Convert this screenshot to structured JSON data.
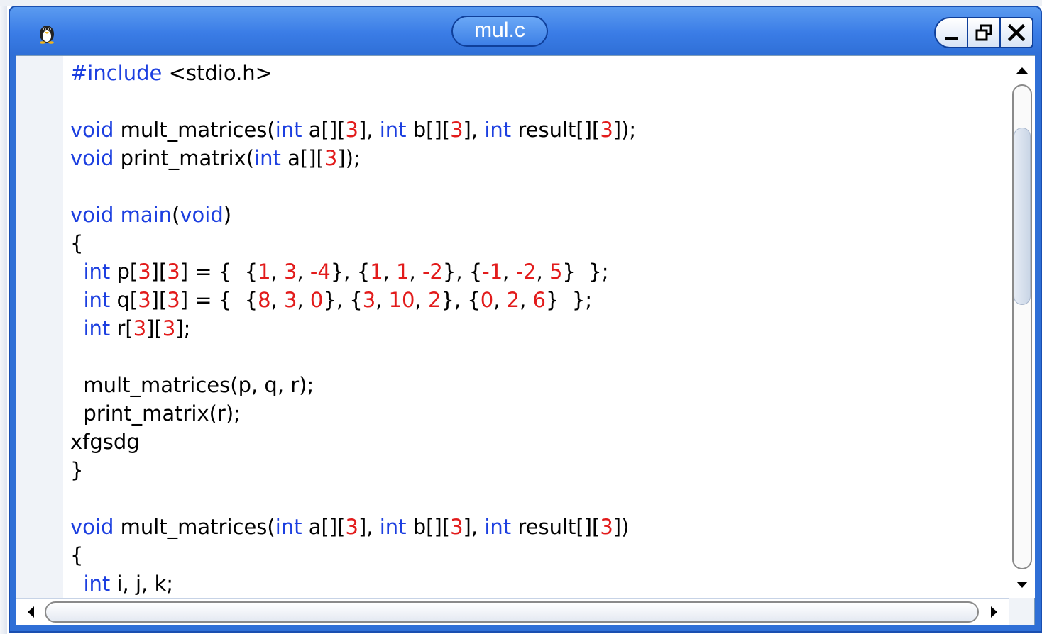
{
  "window": {
    "title": "mul.c",
    "icon": "penguin-icon",
    "controls": [
      "minimize-icon",
      "restore-icon",
      "close-icon"
    ]
  },
  "editor": {
    "lines": [
      [
        {
          "c": "kw",
          "t": "#include"
        },
        {
          "c": "t",
          "t": " <stdio.h>"
        }
      ],
      [],
      [
        {
          "c": "kw",
          "t": "void"
        },
        {
          "c": "t",
          "t": " mult_matrices("
        },
        {
          "c": "kw",
          "t": "int"
        },
        {
          "c": "t",
          "t": " a[]["
        },
        {
          "c": "num",
          "t": "3"
        },
        {
          "c": "t",
          "t": "], "
        },
        {
          "c": "kw",
          "t": "int"
        },
        {
          "c": "t",
          "t": " b[]["
        },
        {
          "c": "num",
          "t": "3"
        },
        {
          "c": "t",
          "t": "], "
        },
        {
          "c": "kw",
          "t": "int"
        },
        {
          "c": "t",
          "t": " result[]["
        },
        {
          "c": "num",
          "t": "3"
        },
        {
          "c": "t",
          "t": "]);"
        }
      ],
      [
        {
          "c": "kw",
          "t": "void"
        },
        {
          "c": "t",
          "t": " print_matrix("
        },
        {
          "c": "kw",
          "t": "int"
        },
        {
          "c": "t",
          "t": " a[]["
        },
        {
          "c": "num",
          "t": "3"
        },
        {
          "c": "t",
          "t": "]);"
        }
      ],
      [],
      [
        {
          "c": "kw",
          "t": "void"
        },
        {
          "c": "t",
          "t": " "
        },
        {
          "c": "kw",
          "t": "main"
        },
        {
          "c": "t",
          "t": "("
        },
        {
          "c": "kw",
          "t": "void"
        },
        {
          "c": "t",
          "t": ")"
        }
      ],
      [
        {
          "c": "t",
          "t": "{"
        }
      ],
      [
        {
          "c": "t",
          "t": "  "
        },
        {
          "c": "kw",
          "t": "int"
        },
        {
          "c": "t",
          "t": " p["
        },
        {
          "c": "num",
          "t": "3"
        },
        {
          "c": "t",
          "t": "]["
        },
        {
          "c": "num",
          "t": "3"
        },
        {
          "c": "t",
          "t": "] = {  {"
        },
        {
          "c": "num",
          "t": "1"
        },
        {
          "c": "t",
          "t": ", "
        },
        {
          "c": "num",
          "t": "3"
        },
        {
          "c": "t",
          "t": ", "
        },
        {
          "c": "num",
          "t": "-4"
        },
        {
          "c": "t",
          "t": "}, {"
        },
        {
          "c": "num",
          "t": "1"
        },
        {
          "c": "t",
          "t": ", "
        },
        {
          "c": "num",
          "t": "1"
        },
        {
          "c": "t",
          "t": ", "
        },
        {
          "c": "num",
          "t": "-2"
        },
        {
          "c": "t",
          "t": "}, {"
        },
        {
          "c": "num",
          "t": "-1"
        },
        {
          "c": "t",
          "t": ", "
        },
        {
          "c": "num",
          "t": "-2"
        },
        {
          "c": "t",
          "t": ", "
        },
        {
          "c": "num",
          "t": "5"
        },
        {
          "c": "t",
          "t": "}  };"
        }
      ],
      [
        {
          "c": "t",
          "t": "  "
        },
        {
          "c": "kw",
          "t": "int"
        },
        {
          "c": "t",
          "t": " q["
        },
        {
          "c": "num",
          "t": "3"
        },
        {
          "c": "t",
          "t": "]["
        },
        {
          "c": "num",
          "t": "3"
        },
        {
          "c": "t",
          "t": "] = {  {"
        },
        {
          "c": "num",
          "t": "8"
        },
        {
          "c": "t",
          "t": ", "
        },
        {
          "c": "num",
          "t": "3"
        },
        {
          "c": "t",
          "t": ", "
        },
        {
          "c": "num",
          "t": "0"
        },
        {
          "c": "t",
          "t": "}, {"
        },
        {
          "c": "num",
          "t": "3"
        },
        {
          "c": "t",
          "t": ", "
        },
        {
          "c": "num",
          "t": "10"
        },
        {
          "c": "t",
          "t": ", "
        },
        {
          "c": "num",
          "t": "2"
        },
        {
          "c": "t",
          "t": "}, {"
        },
        {
          "c": "num",
          "t": "0"
        },
        {
          "c": "t",
          "t": ", "
        },
        {
          "c": "num",
          "t": "2"
        },
        {
          "c": "t",
          "t": ", "
        },
        {
          "c": "num",
          "t": "6"
        },
        {
          "c": "t",
          "t": "}  };"
        }
      ],
      [
        {
          "c": "t",
          "t": "  "
        },
        {
          "c": "kw",
          "t": "int"
        },
        {
          "c": "t",
          "t": " r["
        },
        {
          "c": "num",
          "t": "3"
        },
        {
          "c": "t",
          "t": "]["
        },
        {
          "c": "num",
          "t": "3"
        },
        {
          "c": "t",
          "t": "];"
        }
      ],
      [],
      [
        {
          "c": "t",
          "t": "  mult_matrices(p, q, r);"
        }
      ],
      [
        {
          "c": "t",
          "t": "  print_matrix(r);"
        }
      ],
      [
        {
          "c": "t",
          "t": "xfgsdg"
        }
      ],
      [
        {
          "c": "t",
          "t": "}"
        }
      ],
      [],
      [
        {
          "c": "kw",
          "t": "void"
        },
        {
          "c": "t",
          "t": " mult_matrices("
        },
        {
          "c": "kw",
          "t": "int"
        },
        {
          "c": "t",
          "t": " a[]["
        },
        {
          "c": "num",
          "t": "3"
        },
        {
          "c": "t",
          "t": "], "
        },
        {
          "c": "kw",
          "t": "int"
        },
        {
          "c": "t",
          "t": " b[]["
        },
        {
          "c": "num",
          "t": "3"
        },
        {
          "c": "t",
          "t": "], "
        },
        {
          "c": "kw",
          "t": "int"
        },
        {
          "c": "t",
          "t": " result[]["
        },
        {
          "c": "num",
          "t": "3"
        },
        {
          "c": "t",
          "t": "])"
        }
      ],
      [
        {
          "c": "t",
          "t": "{"
        }
      ],
      [
        {
          "c": "t",
          "t": "  "
        },
        {
          "c": "kw",
          "t": "int"
        },
        {
          "c": "t",
          "t": " i, j, k;"
        }
      ]
    ]
  },
  "scrollbars": {
    "vertical_position": 0.25,
    "horizontal_position": 0.0
  }
}
